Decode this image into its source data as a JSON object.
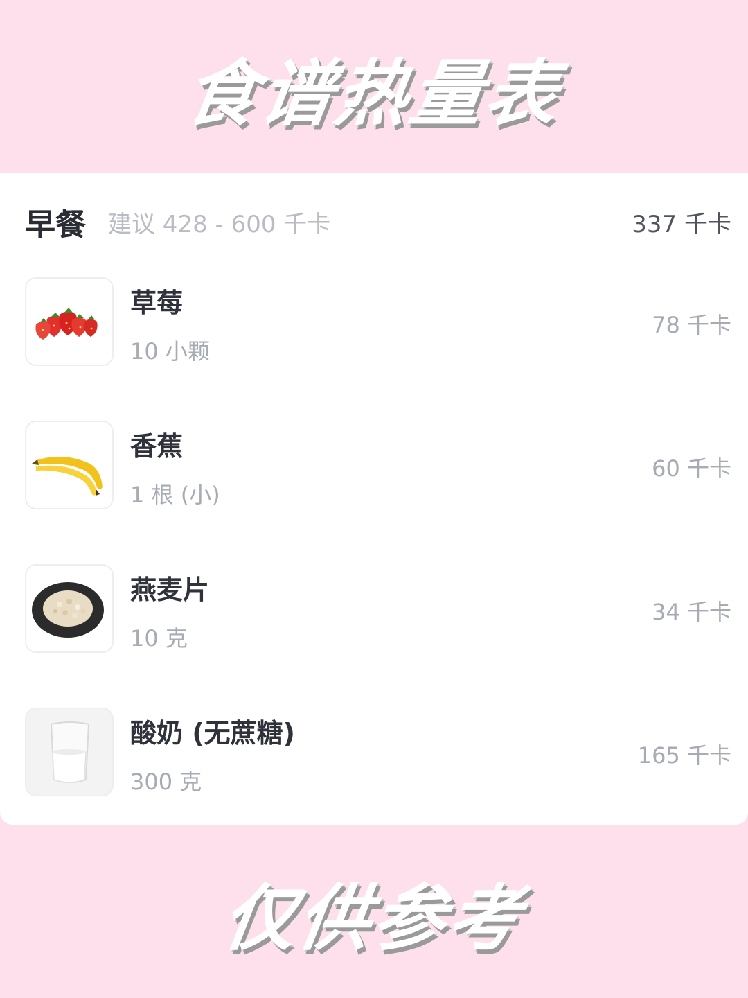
{
  "banner": {
    "title": "食谱热量表",
    "footer": "仅供参考"
  },
  "meal": {
    "name": "早餐",
    "suggestion": "建议 428 - 600 千卡",
    "total": "337 千卡",
    "items": [
      {
        "icon": "strawberry-icon",
        "name": "草莓",
        "amount": "10 小颗",
        "kcal": "78 千卡"
      },
      {
        "icon": "banana-icon",
        "name": "香蕉",
        "amount": "1 根 (小)",
        "kcal": "60 千卡"
      },
      {
        "icon": "oats-icon",
        "name": "燕麦片",
        "amount": "10 克",
        "kcal": "34 千卡"
      },
      {
        "icon": "yogurt-icon",
        "name": "酸奶 (无蔗糖)",
        "amount": "300 克",
        "kcal": "165 千卡"
      }
    ]
  },
  "colors": {
    "background": "#fde0ec",
    "card": "#ffffff",
    "text_primary": "#2f323a",
    "text_secondary": "#a7abb4"
  }
}
